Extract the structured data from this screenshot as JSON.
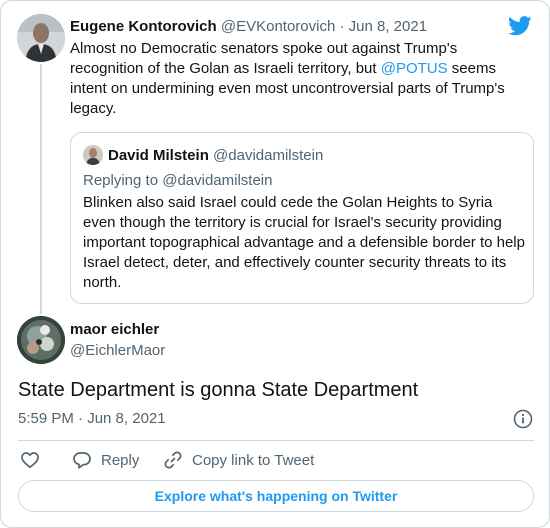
{
  "parent_tweet": {
    "name": "Eugene Kontorovich",
    "handle": "@EVKontorovich",
    "separator": " · ",
    "date": "Jun 8, 2021",
    "text_before": "Almost no Democratic senators spoke out against Trump's recognition of the Golan as Israeli territory, but ",
    "mention": "@POTUS",
    "text_after": " seems intent on undermining even most uncontroversial parts of Trump's legacy."
  },
  "quoted_tweet": {
    "name": "David Milstein",
    "handle": "@davidamilstein",
    "replying_to": "Replying to @davidamilstein",
    "text": "Blinken also said Israel could cede the Golan Heights to Syria even though the territory is crucial for Israel's security providing important topographical advantage and a defensible border to help Israel detect, deter, and effectively counter security threats to its north."
  },
  "main_tweet": {
    "name": "maor eichler",
    "handle": "@EichlerMaor",
    "text": "State Department is gonna State Department",
    "timestamp": "5:59 PM · Jun 8, 2021"
  },
  "actions": {
    "like_icon": "heart-icon",
    "reply_label": "Reply",
    "reply_icon": "reply-icon",
    "copy_label": "Copy link to Tweet",
    "copy_icon": "link-icon"
  },
  "explore_label": "Explore what's happening on Twitter",
  "colors": {
    "accent": "#1d9bf0",
    "text": "#0f1419",
    "secondary": "#536471",
    "border": "#cfd9de"
  }
}
